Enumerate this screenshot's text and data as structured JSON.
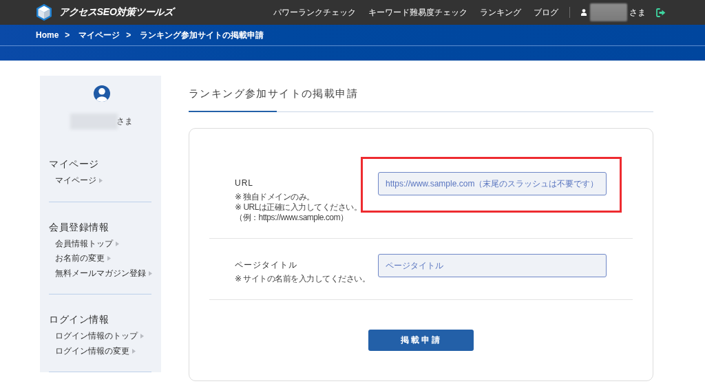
{
  "header": {
    "logo": "アクセスSEO対策ツールズ",
    "nav": [
      {
        "label": "パワーランクチェック"
      },
      {
        "label": "キーワード難易度チェック"
      },
      {
        "label": "ランキング"
      },
      {
        "label": "ブログ"
      }
    ],
    "user_suffix": "さま"
  },
  "breadcrumb": [
    {
      "label": "Home",
      "separator": ">"
    },
    {
      "label": "マイページ",
      "separator": ">"
    },
    {
      "label": "ランキング参加サイトの掲載申請"
    }
  ],
  "sidebar": {
    "user_suffix": "さま",
    "sections": [
      {
        "heading": "マイページ",
        "items": [
          {
            "label": "マイページ"
          }
        ]
      },
      {
        "heading": "会員登録情報",
        "items": [
          {
            "label": "会員情報トップ"
          },
          {
            "label": "お名前の変更"
          },
          {
            "label": "無料メールマガジン登録"
          }
        ]
      },
      {
        "heading": "ログイン情報",
        "items": [
          {
            "label": "ログイン情報のトップ"
          },
          {
            "label": "ログイン情報の変更"
          }
        ]
      }
    ]
  },
  "page_title": "ランキング参加サイトの掲載申請",
  "form": {
    "fields": [
      {
        "label": "URL",
        "notes": [
          "※ 独自ドメインのみ。",
          "※ URLは正確に入力してください。",
          "（例：https://www.sample.com）"
        ],
        "placeholder": "https://www.sample.com（末尾のスラッシュは不要です）",
        "highlighted": true
      },
      {
        "label": "ページタイトル",
        "notes": [
          "※ サイトの名前を入力してください。"
        ],
        "placeholder": "ページタイトル",
        "highlighted": false
      }
    ],
    "submit": "掲載申請"
  }
}
